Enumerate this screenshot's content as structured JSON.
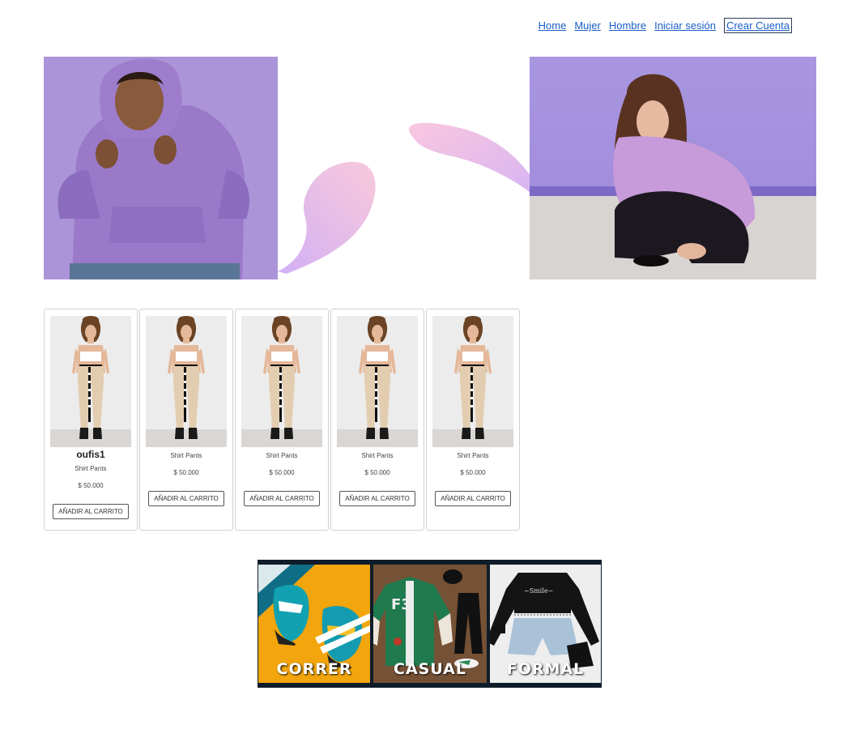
{
  "nav": {
    "items": [
      {
        "label": "Home"
      },
      {
        "label": "Mujer"
      },
      {
        "label": "Hombre"
      },
      {
        "label": "Iniciar sesión"
      },
      {
        "label": "Crear Cuenta"
      }
    ]
  },
  "colors": {
    "link": "#1a5fc8",
    "hero_bg_purple": "#a78fd6",
    "blob_pink": "#f6c6dc",
    "blob_violet": "#d7b1f3"
  },
  "products": [
    {
      "title": "oufis1",
      "name": "Shirt Pants",
      "price": "$ 50.000",
      "button": "AÑADIR AL CARRITO"
    },
    {
      "title": "",
      "name": "Shirt Pants",
      "price": "$ 50.000",
      "button": "AÑADIR AL CARRITO"
    },
    {
      "title": "",
      "name": "Shirt Pants",
      "price": "$ 50.000",
      "button": "AÑADIR AL CARRITO"
    },
    {
      "title": "",
      "name": "Shirt Pants",
      "price": "$ 50.000",
      "button": "AÑADIR AL CARRITO"
    },
    {
      "title": "",
      "name": "Shirt Pants",
      "price": "$ 50.000",
      "button": "AÑADIR AL CARRITO"
    }
  ],
  "categories": [
    {
      "label": "CORRER"
    },
    {
      "label": "CASUAL"
    },
    {
      "label": "FORMAL"
    }
  ]
}
